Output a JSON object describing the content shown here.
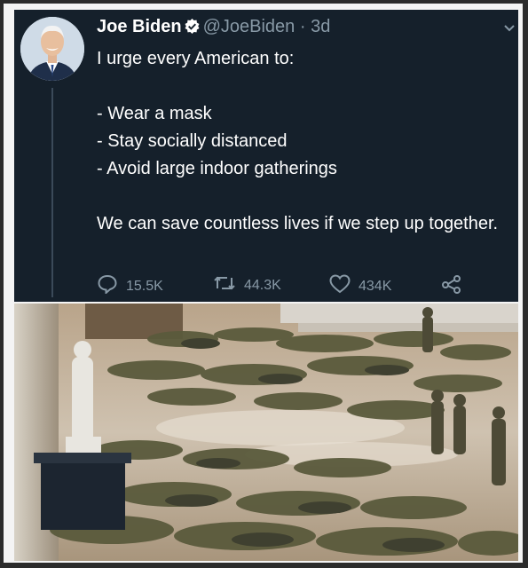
{
  "tweet": {
    "author_name": "Joe Biden",
    "handle": "@JoeBiden",
    "separator": "·",
    "time": "3d",
    "lines": [
      "I urge every American to:",
      "",
      "- Wear a mask",
      "- Stay socially distanced",
      "- Avoid large indoor gatherings",
      "",
      "We can save countless lives if we step up together."
    ],
    "actions": {
      "reply_count": "15.5K",
      "retweet_count": "44.3K",
      "like_count": "434K"
    },
    "icons": [
      "verified-badge-icon",
      "chevron-down-icon",
      "reply-icon",
      "retweet-icon",
      "like-icon",
      "share-icon"
    ]
  },
  "colors": {
    "tweet_background": "#15202b",
    "text_primary": "#ffffff",
    "text_secondary": "#8899a6",
    "verified": "#ffffff"
  }
}
